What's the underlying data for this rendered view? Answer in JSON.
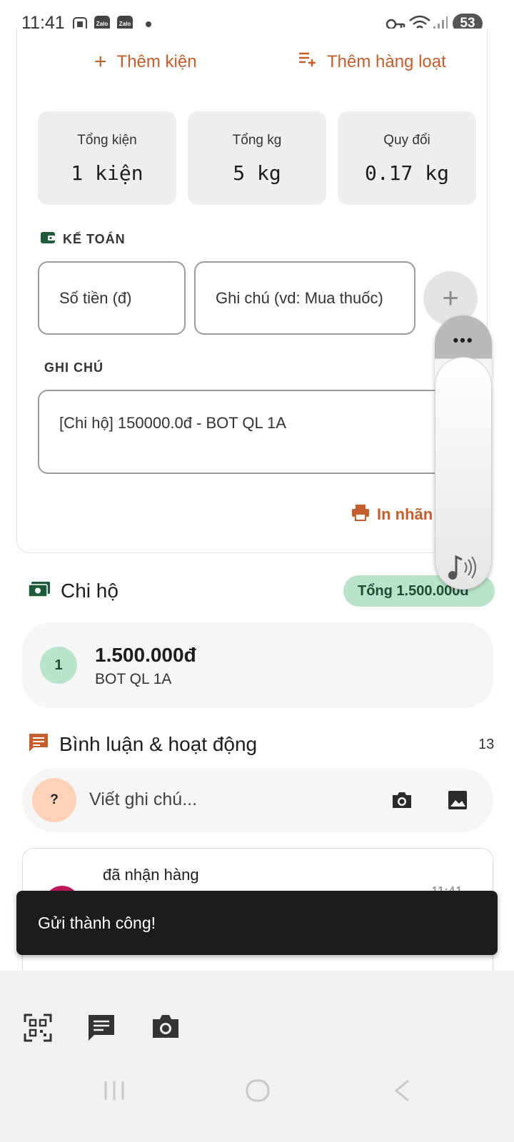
{
  "status_bar": {
    "time": "11:41",
    "app_icon_1": "Zalo",
    "app_icon_2": "Zalo",
    "battery": "53"
  },
  "actions": {
    "add_package": "Thêm kiện",
    "add_bulk": "Thêm hàng loạt"
  },
  "stats": [
    {
      "label": "Tổng kiện",
      "value": "1 kiện"
    },
    {
      "label": "Tổng kg",
      "value": "5 kg"
    },
    {
      "label": "Quy đổi",
      "value": "0.17 kg"
    }
  ],
  "accounting": {
    "title": "KẾ TOÁN",
    "amount_placeholder": "Số tiền (đ)",
    "note_placeholder": "Ghi chú (vd: Mua thuốc)"
  },
  "notes": {
    "title": "GHI CHÚ",
    "value": "[Chi hộ] 150000.0đ - BOT QL 1A"
  },
  "print_label": "In nhãn l",
  "side_panel": {
    "dots": "•••"
  },
  "chi_ho": {
    "title": "Chi hộ",
    "total": "Tổng 1.500.000đ",
    "items": [
      {
        "index": "1",
        "amount": "1.500.000đ",
        "desc": "BOT QL 1A"
      }
    ]
  },
  "comments": {
    "title": "Bình luận & hoạt động",
    "count": "13",
    "avatar": "?",
    "placeholder": "Viết ghi chú...",
    "activity": {
      "text": "đã nhận hàng",
      "time": "11:41"
    }
  },
  "toast": "Gửi thành công!",
  "colors": {
    "accent": "#c55d2c",
    "green_pill": "#b9e4cb",
    "toast_bg": "#1c1c1c"
  }
}
